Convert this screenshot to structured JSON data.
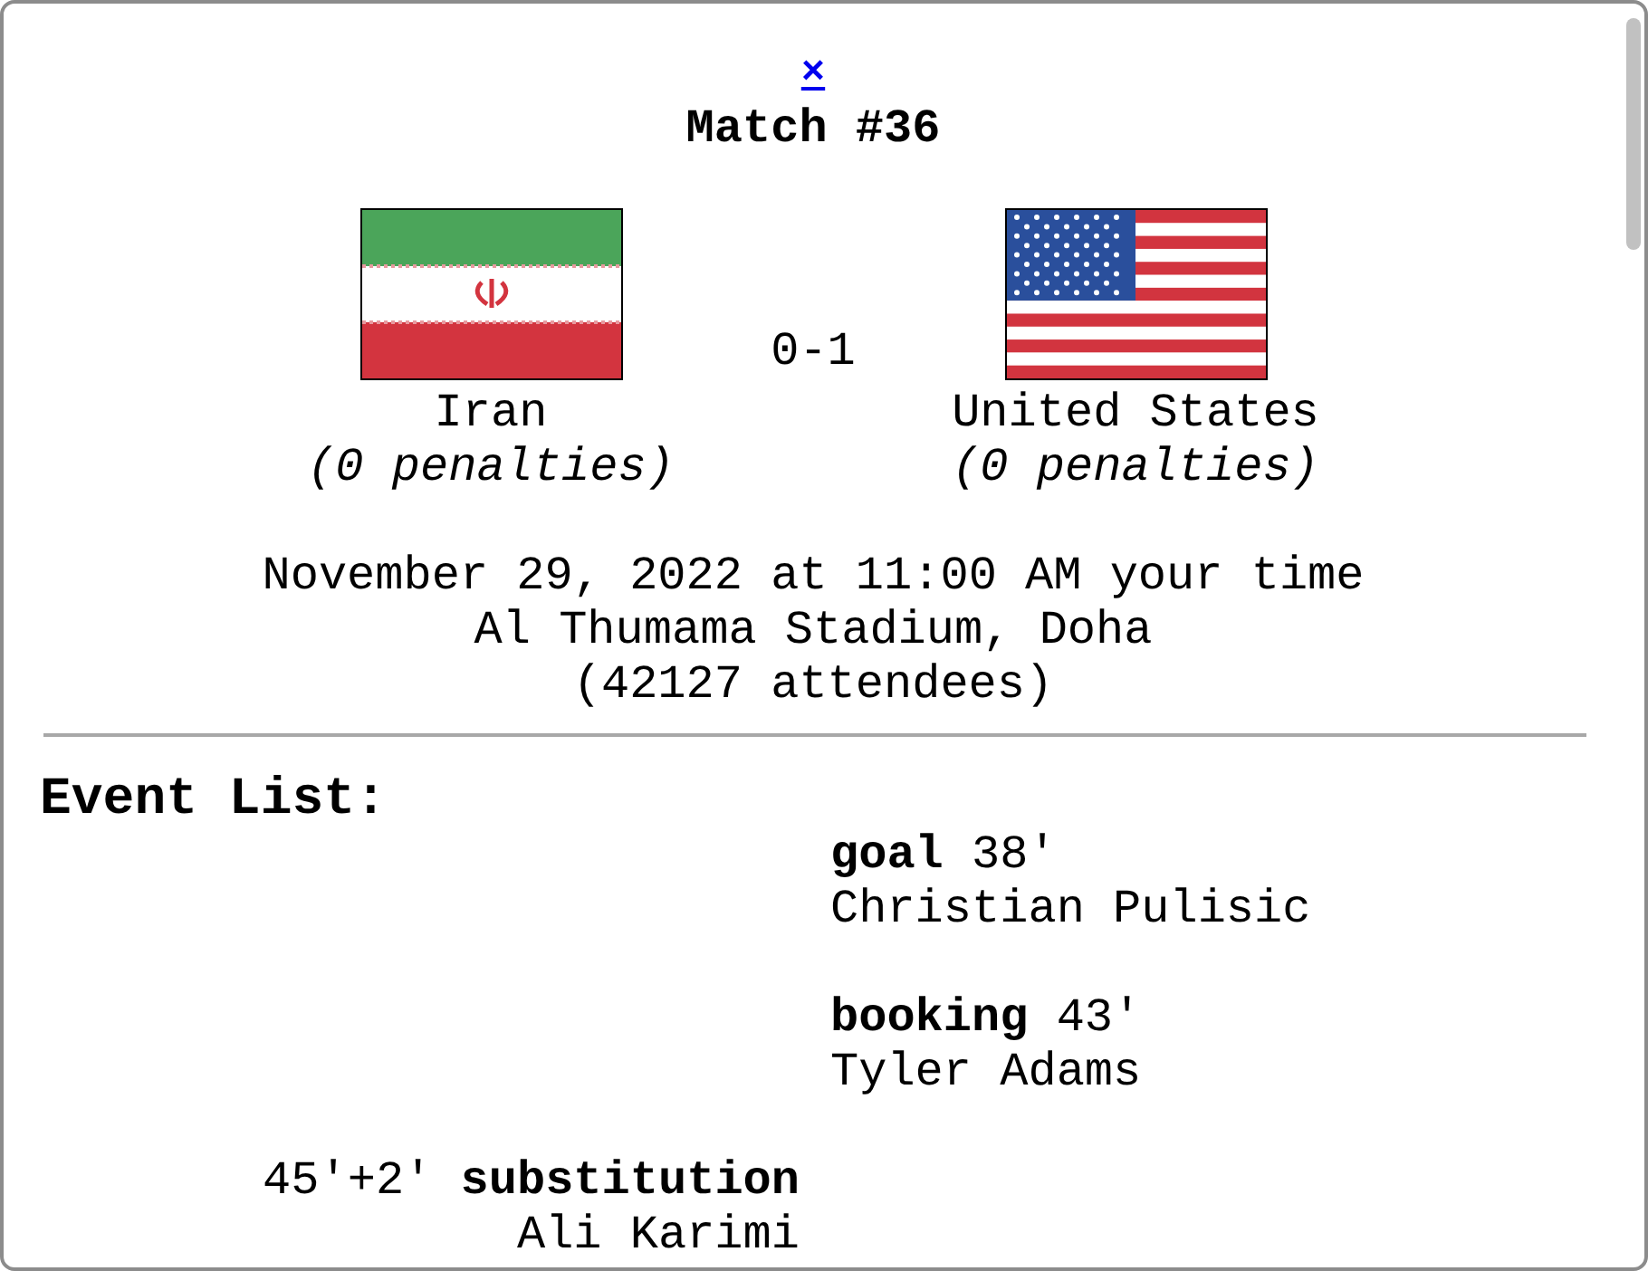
{
  "close_link": "×",
  "title": "Match #36",
  "teams": [
    {
      "kind": "iran",
      "name": "Iran",
      "penalties": "(0 penalties)"
    },
    {
      "kind": "usa",
      "name": "United States",
      "penalties": "(0 penalties)"
    }
  ],
  "score": "0-1",
  "datetime": "November 29, 2022 at 11:00 AM your time",
  "venue": "Al Thumama Stadium, Doha",
  "attendance": "(42127 attendees)",
  "events_heading": "Event List:",
  "events": [
    {
      "kind": "away",
      "type": "goal",
      "minute": "38'",
      "player": "Christian Pulisic"
    },
    {
      "kind": "away",
      "type": "booking",
      "minute": "43'",
      "player": "Tyler Adams"
    },
    {
      "kind": "home",
      "type": "substitution",
      "minute": "45'+2'",
      "player": "Ali Karimi"
    }
  ]
}
